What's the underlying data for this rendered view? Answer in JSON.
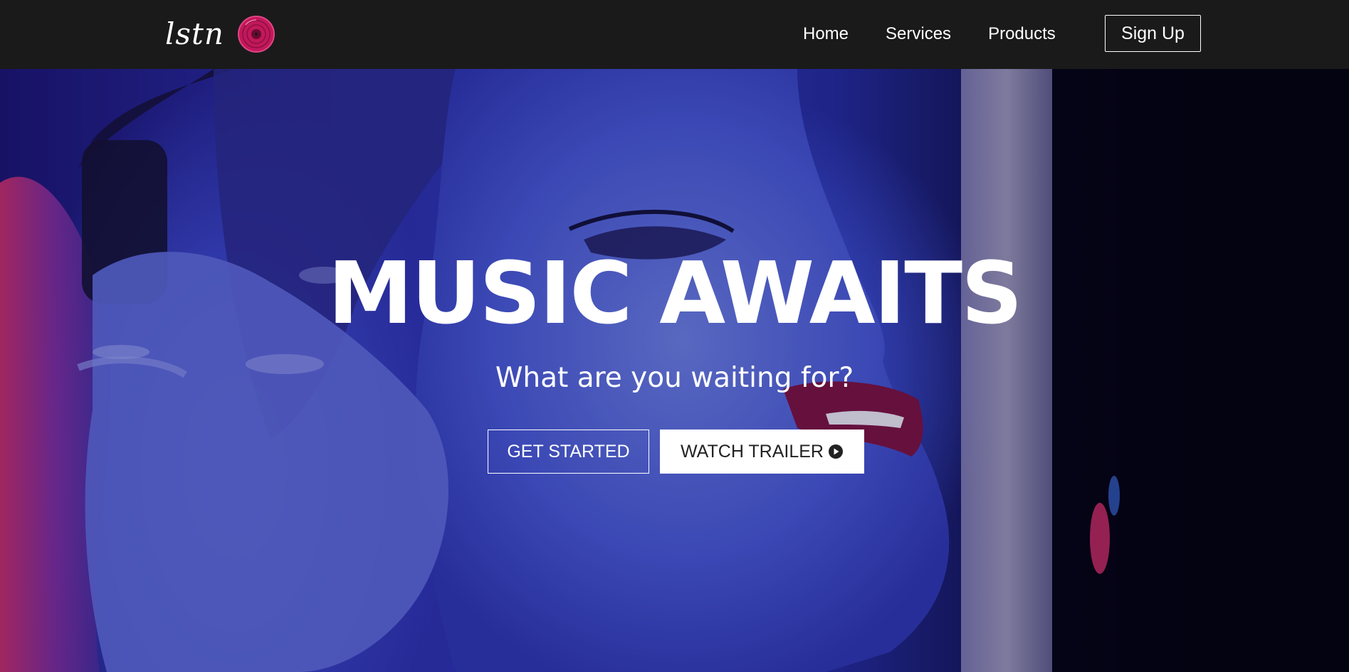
{
  "brand": {
    "logo_text": "lstn",
    "logo_icon": "vinyl-disc-icon",
    "accent_color": "#c2185b"
  },
  "nav": {
    "links": [
      {
        "label": "Home"
      },
      {
        "label": "Services"
      },
      {
        "label": "Products"
      }
    ],
    "signup_label": "Sign Up"
  },
  "hero": {
    "title": "MUSIC AWAITS",
    "subtitle": "What are you waiting for?",
    "primary_button": "GET STARTED",
    "secondary_button": "WATCH TRAILER",
    "secondary_button_icon": "play-circle-icon",
    "background_colors": [
      "#2f36b8",
      "#5a6fd8",
      "#050413",
      "#e0306a"
    ]
  }
}
